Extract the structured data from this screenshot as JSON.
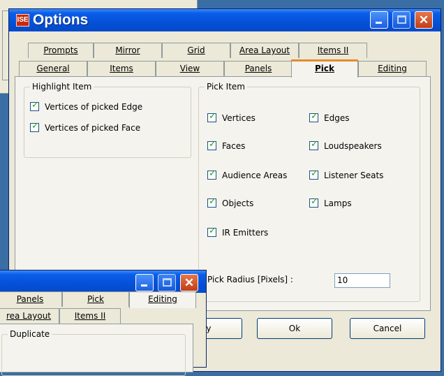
{
  "main_window": {
    "title": "Options",
    "icon_text": "ISE",
    "controls": {
      "minimize": "minimize-icon",
      "maximize": "maximize-icon",
      "close": "close-icon"
    },
    "tabs_row_back": [
      "Prompts",
      "Mirror",
      "Grid",
      "Area Layout",
      "Items II"
    ],
    "tabs_row_front": [
      "General",
      "Items",
      "View",
      "Panels",
      "Pick",
      "Editing"
    ],
    "active_tab": "Pick",
    "highlight_group": {
      "label": "Highlight Item",
      "items": [
        {
          "label": "Vertices of picked Edge",
          "checked": true
        },
        {
          "label": "Vertices of picked Face",
          "checked": true
        }
      ]
    },
    "pick_group": {
      "label": "Pick Item",
      "items": [
        {
          "label": "Vertices",
          "checked": true
        },
        {
          "label": "Edges",
          "checked": true
        },
        {
          "label": "Faces",
          "checked": true
        },
        {
          "label": "Loudspeakers",
          "checked": true
        },
        {
          "label": "Audience Areas",
          "checked": true
        },
        {
          "label": "Listener Seats",
          "checked": true
        },
        {
          "label": "Objects",
          "checked": true
        },
        {
          "label": "Lamps",
          "checked": true
        },
        {
          "label": "IR Emitters",
          "checked": true
        }
      ],
      "radius_label": "Pick Radius [Pixels] :",
      "radius_value": "10"
    },
    "buttons": {
      "apply_partial": "ly",
      "ok": "Ok",
      "cancel": "Cancel"
    }
  },
  "second_window": {
    "tabs_row_back": [
      "rea Layout",
      "Items II"
    ],
    "tabs_row_front": [
      "Panels",
      "Pick",
      "Editing"
    ],
    "group_label": "Duplicate"
  },
  "colors": {
    "titlebar": "#0550d8",
    "desktop": "#3a6ea5",
    "dialog": "#ece9d8",
    "check": "#21a121"
  }
}
